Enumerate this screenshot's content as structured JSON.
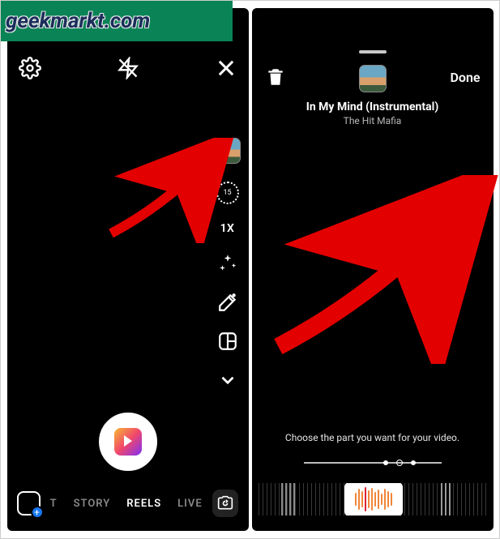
{
  "watermark": "geekmarkt.com",
  "left": {
    "tools": {
      "timer_label": "15",
      "speed_label": "1X"
    },
    "modes": {
      "story": "STORY",
      "reels": "REELS",
      "live": "LIVE",
      "t": "T"
    }
  },
  "right": {
    "done_label": "Done",
    "song": {
      "title": "In My Mind (Instrumental)",
      "artist": "The Hit Mafia"
    },
    "instruction": "Choose the part you want for your video."
  }
}
